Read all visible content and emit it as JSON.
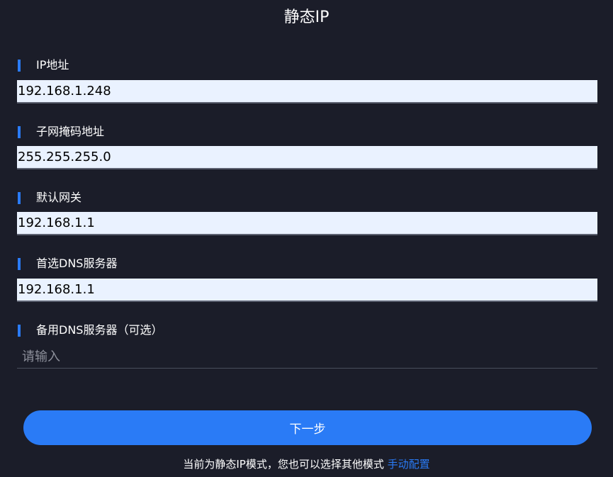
{
  "page": {
    "title": "静态IP"
  },
  "fields": [
    {
      "label": "IP地址",
      "value": "192.168.1.248",
      "placeholder": ""
    },
    {
      "label": "子网掩码地址",
      "value": "255.255.255.0",
      "placeholder": ""
    },
    {
      "label": "默认网关",
      "value": "192.168.1.1",
      "placeholder": ""
    },
    {
      "label": "首选DNS服务器",
      "value": "192.168.1.1",
      "placeholder": ""
    },
    {
      "label": "备用DNS服务器（可选）",
      "value": "",
      "placeholder": "请输入"
    }
  ],
  "actions": {
    "next_label": "下一步"
  },
  "footer": {
    "note": "当前为静态IP模式，您也可以选择其他模式",
    "link_label": "手动配置"
  },
  "colors": {
    "background": "#1b1d29",
    "accent": "#2a7bf6",
    "input_background": "#eaf2ff"
  }
}
